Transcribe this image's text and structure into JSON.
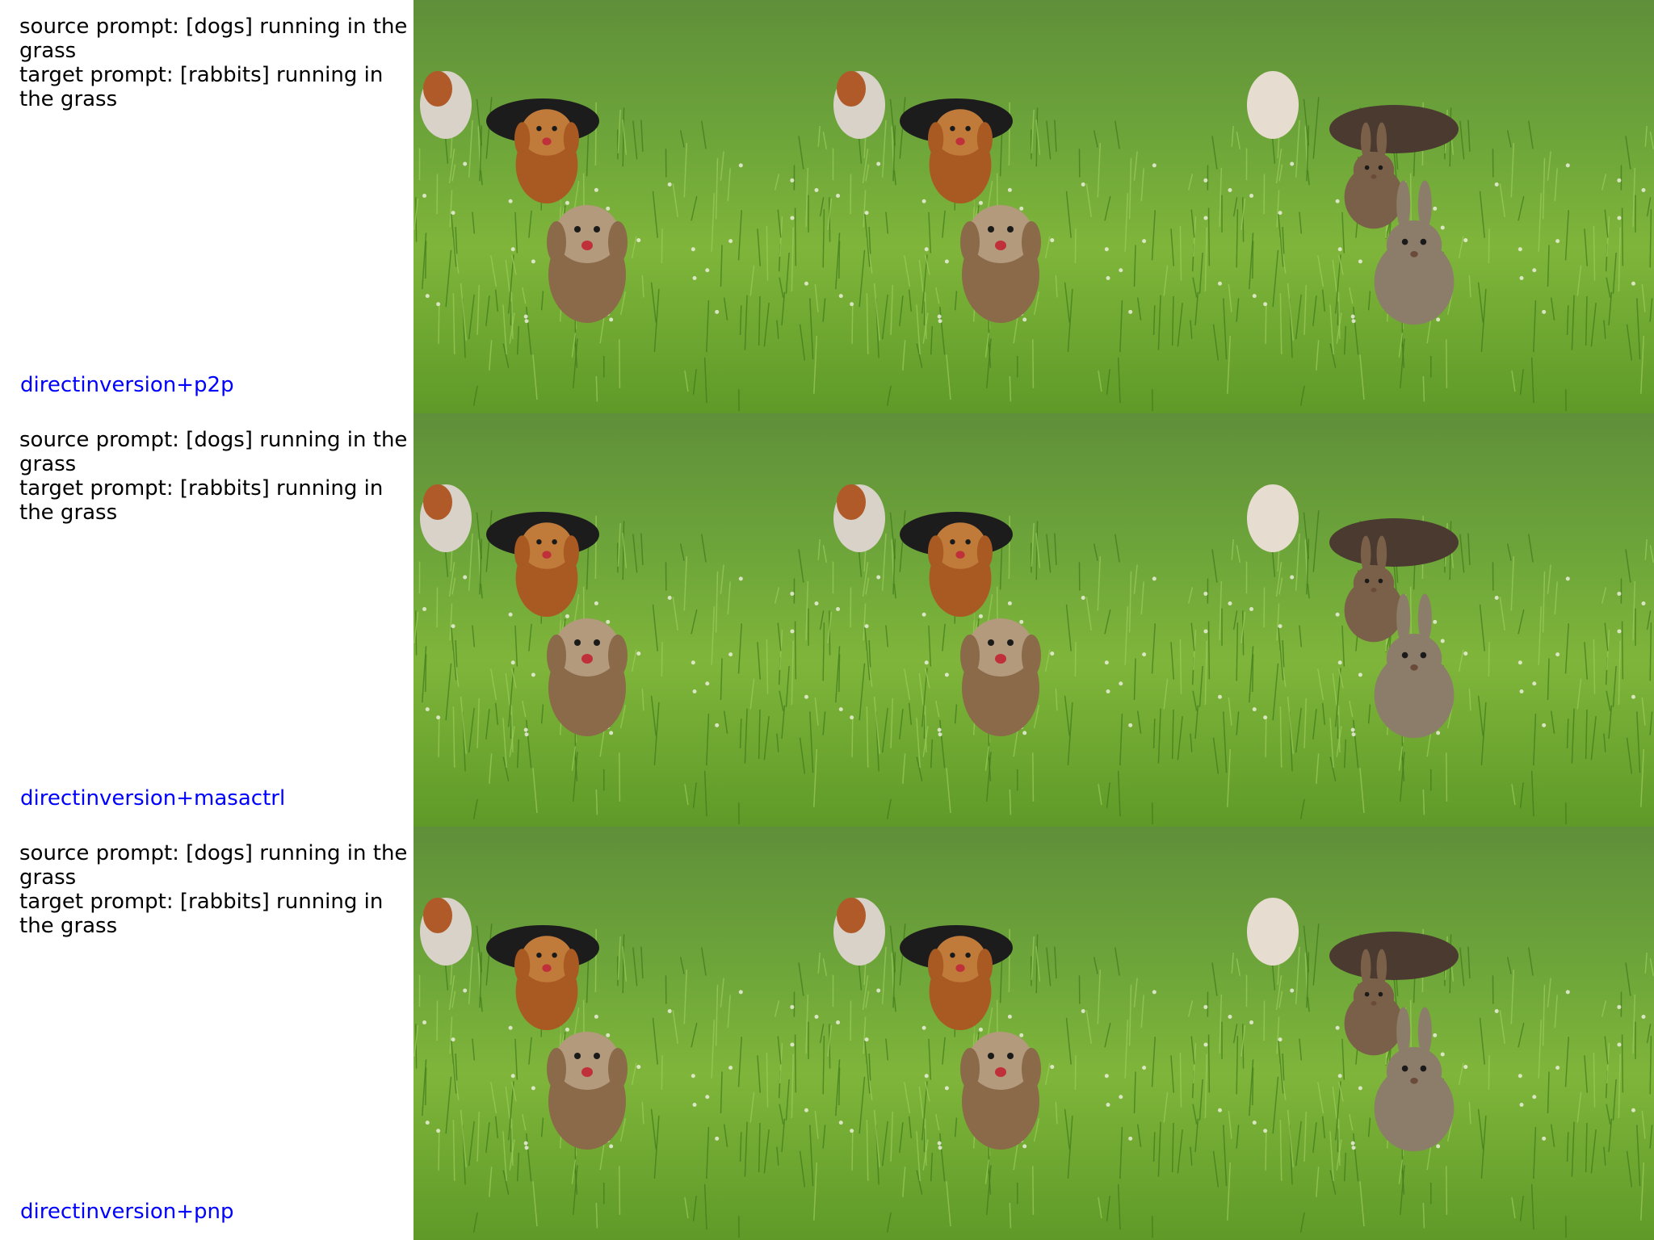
{
  "rows": [
    {
      "source_prompt": "source prompt: [dogs] running in the grass",
      "target_prompt": "target prompt: [rabbits] running in the grass",
      "method": "directinversion+p2p"
    },
    {
      "source_prompt": "source prompt: [dogs] running in the grass",
      "target_prompt": "target prompt: [rabbits] running in the grass",
      "method": "directinversion+masactrl"
    },
    {
      "source_prompt": "source prompt: [dogs] running in the grass",
      "target_prompt": "target prompt: [rabbits] running in the grass",
      "method": "directinversion+pnp"
    }
  ],
  "colors": {
    "method_label": "#0000ff",
    "prompt_text": "#000000",
    "grass_dark": "#3f7a1c",
    "grass_light": "#7fb53a"
  },
  "tiles": [
    [
      "dog-photo",
      "dog-photo",
      "rabbit-photo"
    ],
    [
      "dog-photo",
      "dog-photo",
      "rabbit-photo"
    ],
    [
      "dog-photo",
      "dog-photo",
      "rabbit-photo"
    ]
  ]
}
